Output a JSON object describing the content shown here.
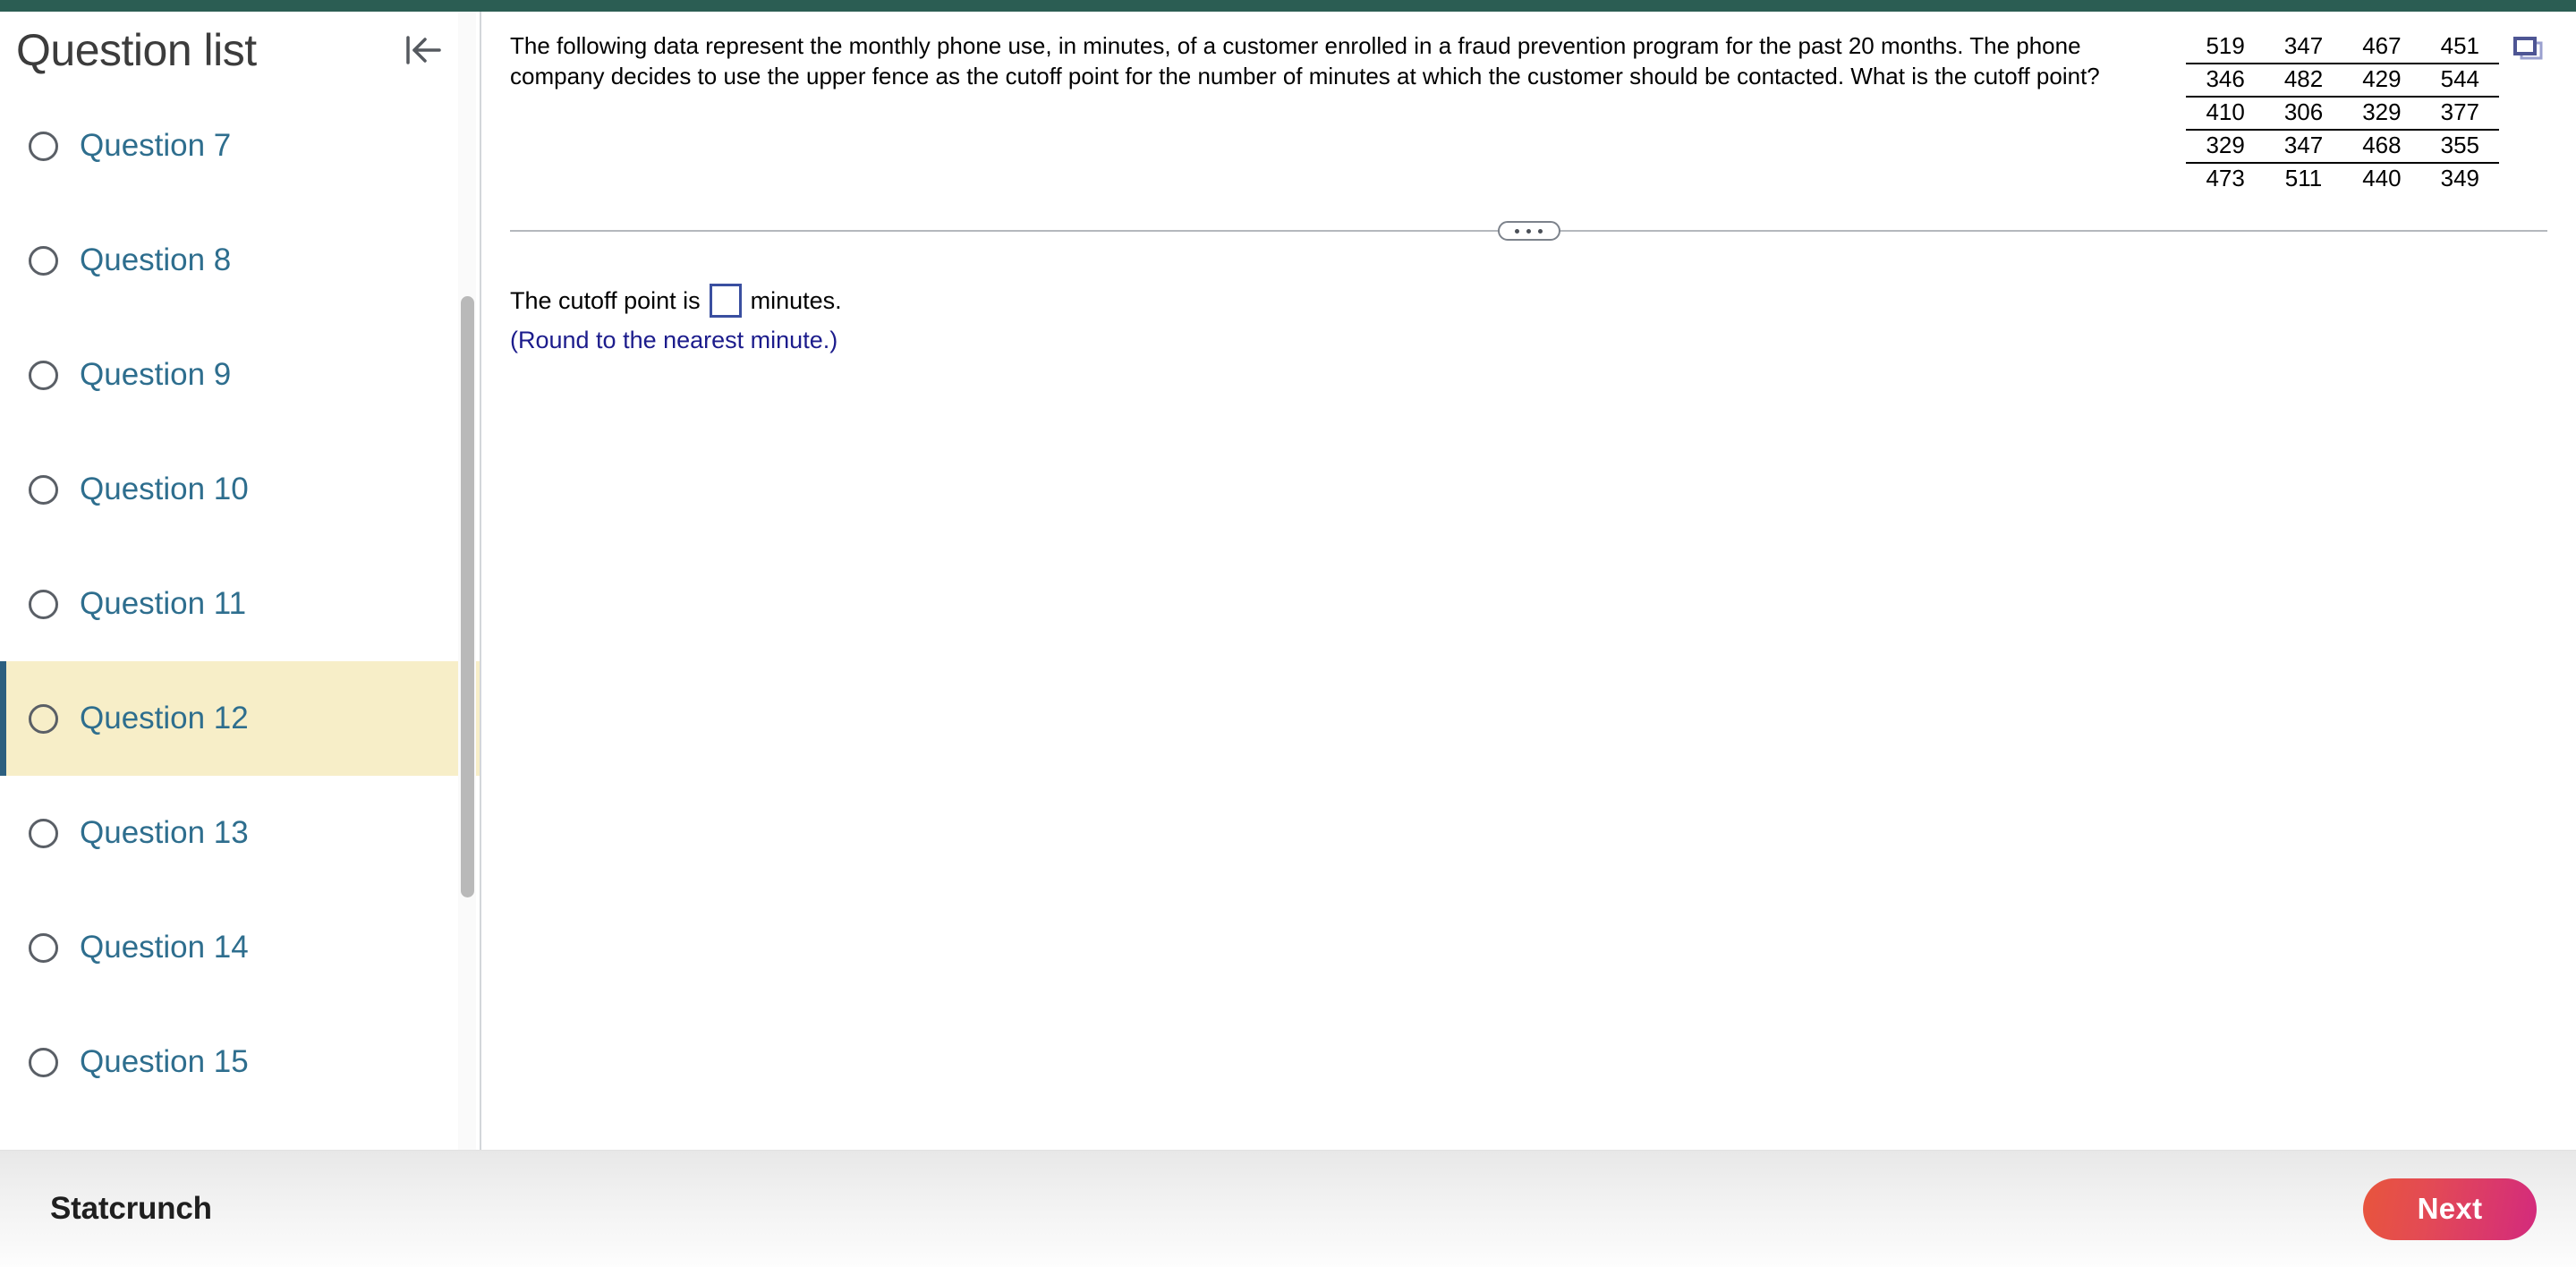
{
  "sidebar": {
    "title": "Question list",
    "collapse_icon": "collapse-left-icon",
    "items": [
      {
        "label": "Question 7",
        "active": false
      },
      {
        "label": "Question 8",
        "active": false
      },
      {
        "label": "Question 9",
        "active": false
      },
      {
        "label": "Question 10",
        "active": false
      },
      {
        "label": "Question 11",
        "active": false
      },
      {
        "label": "Question 12",
        "active": true
      },
      {
        "label": "Question 13",
        "active": false
      },
      {
        "label": "Question 14",
        "active": false
      },
      {
        "label": "Question 15",
        "active": false
      }
    ]
  },
  "question": {
    "text": "The following data represent the monthly phone use, in minutes, of a customer enrolled in a fraud prevention program for the past 20 months. The phone company decides to use the upper fence as the cutoff point for the number of minutes at which the customer should be contacted. What is the cutoff point?",
    "popout_icon": "popout-window-icon"
  },
  "data_table": {
    "rows": [
      [
        "519",
        "347",
        "467",
        "451"
      ],
      [
        "346",
        "482",
        "429",
        "544"
      ],
      [
        "410",
        "306",
        "329",
        "377"
      ],
      [
        "329",
        "347",
        "468",
        "355"
      ],
      [
        "473",
        "511",
        "440",
        "349"
      ]
    ]
  },
  "answer": {
    "prefix": "The cutoff point is",
    "input_value": "",
    "suffix": "minutes.",
    "hint": "(Round to the nearest minute.)"
  },
  "splitter": {
    "handle_icon": "drag-handle-dots-icon"
  },
  "footer": {
    "brand": "Statcrunch",
    "next_label": "Next"
  },
  "colors": {
    "top_bar": "#2b5d53",
    "active_row_bg": "#f7eec8",
    "active_row_accent": "#2c5f7f",
    "link_text": "#2e6e8e",
    "hint_text": "#1c1c8c",
    "input_border": "#3a4fa0",
    "next_gradient_start": "#e8553c",
    "next_gradient_end": "#d32a7d"
  }
}
